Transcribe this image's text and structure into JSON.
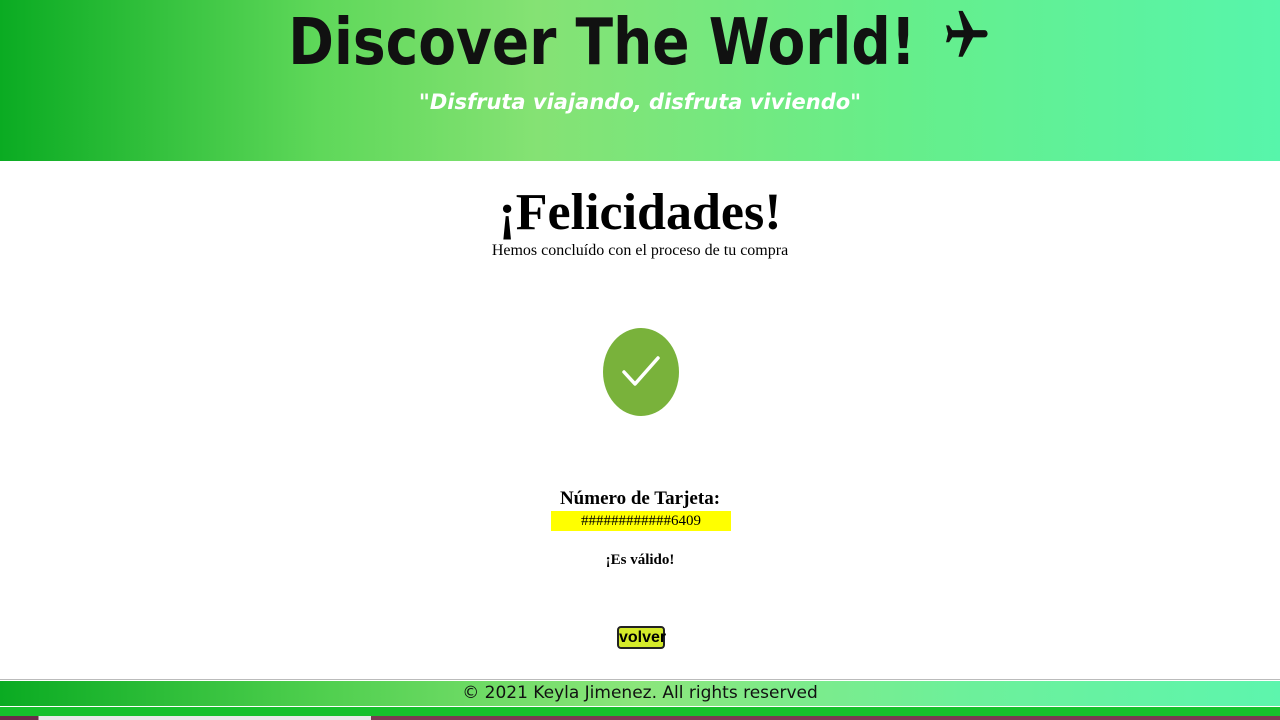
{
  "header": {
    "title": "Discover The World!",
    "plane_icon": "airplane-icon",
    "tagline": "\"Disfruta viajando, disfruta viviendo\""
  },
  "main": {
    "title": "¡Felicidades!",
    "subtitle": "Hemos concluído con el proceso de tu compra",
    "success_icon": "check-circle-icon",
    "card_label": "Número de Tarjeta:",
    "card_number": "############6409",
    "valid_text": "¡Es válido!",
    "back_button_label": "volver"
  },
  "footer": {
    "copyright": "© 2021 Keyla Jimenez. All rights reserved"
  },
  "colors": {
    "header_green_start": "#0aab22",
    "header_green_end": "#57f5ab",
    "check_green": "#79b23b",
    "highlight_yellow": "#ffff00",
    "button_yellow": "#d4ea2a"
  }
}
